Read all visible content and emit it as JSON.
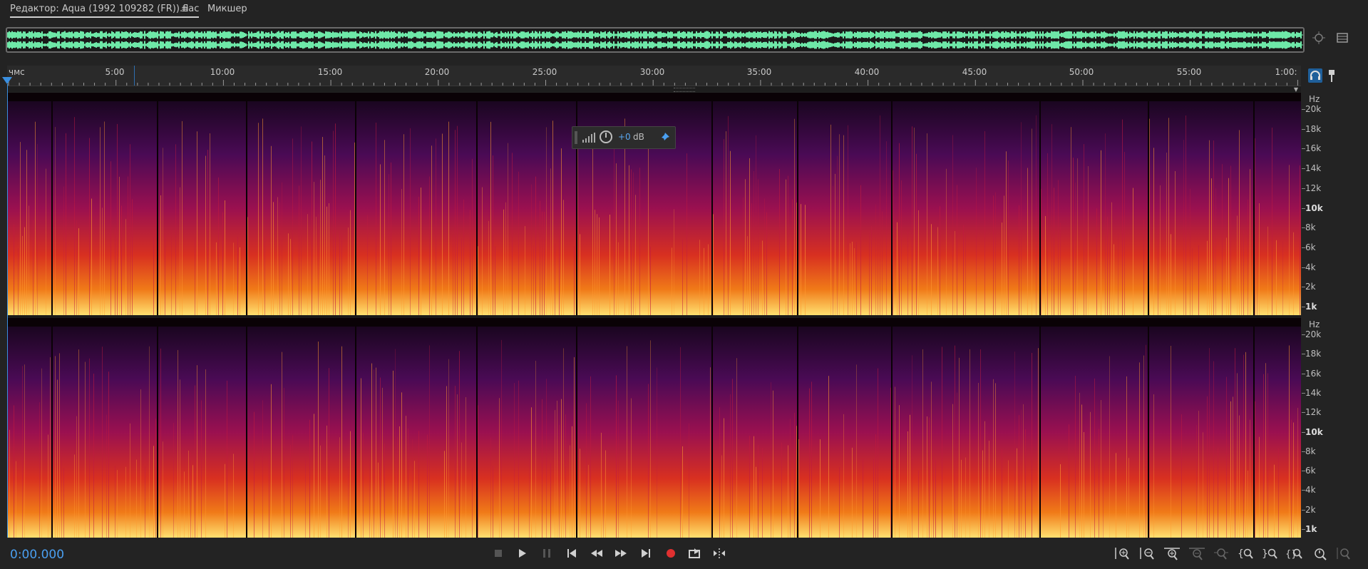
{
  "tabs": {
    "editor_label": "Редактор: Aqua (1992 109282 (FR)).flac",
    "menu_glyph": "≡",
    "mixer_label": "Микшер"
  },
  "ruler": {
    "labels": [
      "чмс",
      "5:00",
      "10:00",
      "15:00",
      "20:00",
      "25:00",
      "30:00",
      "35:00",
      "40:00",
      "45:00",
      "50:00",
      "55:00",
      "1:00:"
    ]
  },
  "hud": {
    "gain_value": "+0",
    "gain_unit": "dB"
  },
  "hz_axis": {
    "unit": "Hz",
    "labels": [
      "20k",
      "18k",
      "16k",
      "14k",
      "12k",
      "10k",
      "8k",
      "6k",
      "4k",
      "2k",
      "1k"
    ],
    "bold_labels": [
      "10k",
      "1k"
    ]
  },
  "transport": {
    "timecode": "0:00.000",
    "buttons": [
      "stop-icon",
      "play-icon",
      "pause-icon",
      "skip-start-icon",
      "rewind-icon",
      "fast-forward-icon",
      "skip-end-icon",
      "record-icon",
      "loop-icon",
      "skip-selection-icon"
    ]
  },
  "zoom_controls": [
    "zoom-in-amplitude-icon",
    "zoom-out-amplitude-icon",
    "zoom-in-time-icon",
    "zoom-out-time-icon",
    "zoom-selection-icon",
    "zoom-in-left-icon",
    "zoom-in-right-icon",
    "zoom-full-icon",
    "zoom-reset-icon",
    "zoom-extra-icon"
  ],
  "colors": {
    "accent_blue": "#4a9ff0",
    "waveform_green": "#6ee8a8",
    "record_red": "#e03030"
  }
}
